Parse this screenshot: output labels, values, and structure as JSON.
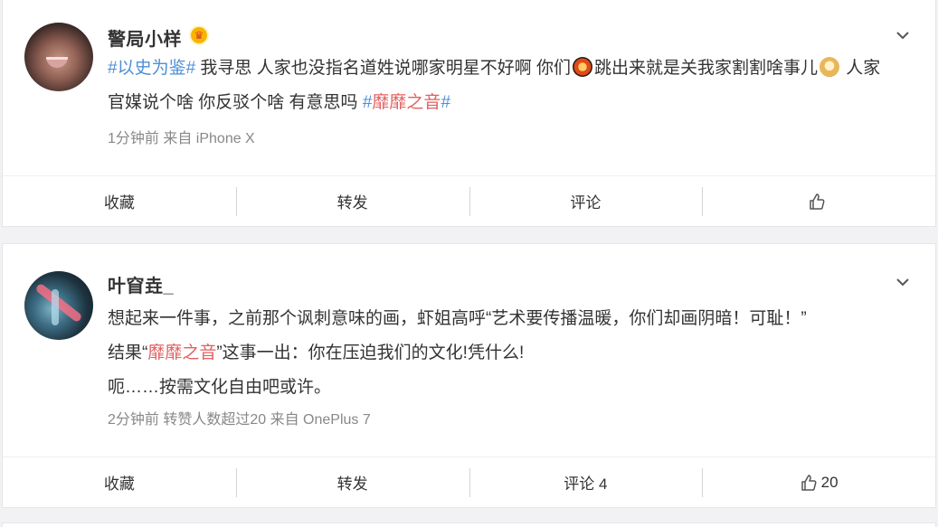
{
  "posts": [
    {
      "username": "警局小样",
      "badge_icon": "crown-icon",
      "content": {
        "tag_start": "#以史为鉴#",
        "text_1": " 我寻思 人家也没指名道姓说哪家明星不好啊 你们",
        "emoji_1": "fire-emoji-icon",
        "text_2": "跳出来就是关我家割割啥事儿",
        "emoji_2": "doge-emoji-icon",
        "text_3": " 人家官媒说个啥 你反驳个啥 有意思吗 ",
        "tag_end_open": "#",
        "tag_end_text": "靡靡之音",
        "tag_end_close": "#"
      },
      "meta": "1分钟前  来自 iPhone X",
      "actions": {
        "favorite": "收藏",
        "repost": "转发",
        "comment": "评论",
        "like_count": ""
      }
    },
    {
      "username": "叶窅垚_",
      "content": {
        "line_1": "想起来一件事，之前那个讽刺意味的画，虾姐高呼“艺术要传播温暖，你们却画阴暗！可耻！”",
        "line_2_prefix": "结果“",
        "line_2_tag": "靡靡之音",
        "line_2_suffix": "”这事一出：你在压迫我们的文化!凭什么!",
        "line_3": "呃……按需文化自由吧或许。"
      },
      "meta": "2分钟前 转赞人数超过20  来自 OnePlus 7",
      "actions": {
        "favorite": "收藏",
        "repost": "转发",
        "comment": "评论 4",
        "like_count": "20"
      }
    }
  ],
  "colors": {
    "hashtag_blue": "#4e8fd6",
    "hashtag_red": "#e25f5f",
    "meta_gray": "#888888",
    "background": "#f2f2f5"
  }
}
